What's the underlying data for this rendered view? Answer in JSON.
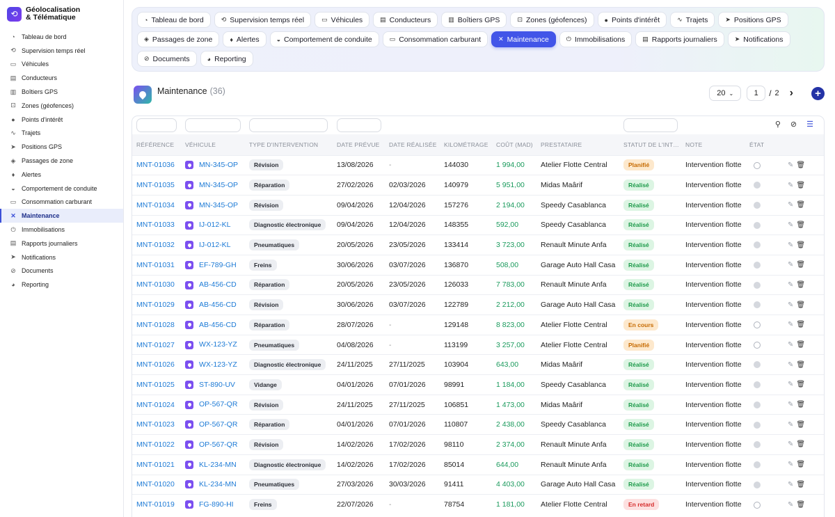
{
  "brand": {
    "line1": "Géolocalisation",
    "line2": "& Télématique"
  },
  "sidebar": {
    "items": [
      {
        "label": "Tableau de bord",
        "icon": "◔"
      },
      {
        "label": "Supervision temps réel",
        "icon": "⟲"
      },
      {
        "label": "Véhicules",
        "icon": "▭"
      },
      {
        "label": "Conducteurs",
        "icon": "▤"
      },
      {
        "label": "Boîtiers GPS",
        "icon": "▥"
      },
      {
        "label": "Zones (géofences)",
        "icon": "⊡"
      },
      {
        "label": "Points d'intérêt",
        "icon": "●"
      },
      {
        "label": "Trajets",
        "icon": "∿"
      },
      {
        "label": "Positions GPS",
        "icon": "➤"
      },
      {
        "label": "Passages de zone",
        "icon": "◈"
      },
      {
        "label": "Alertes",
        "icon": "♦"
      },
      {
        "label": "Comportement de conduite",
        "icon": "◒"
      },
      {
        "label": "Consommation carburant",
        "icon": "▭"
      },
      {
        "label": "Maintenance",
        "icon": "✕"
      },
      {
        "label": "Immobilisations",
        "icon": "⏻"
      },
      {
        "label": "Rapports journaliers",
        "icon": "▤"
      },
      {
        "label": "Notifications",
        "icon": "➤"
      },
      {
        "label": "Documents",
        "icon": "⊘"
      },
      {
        "label": "Reporting",
        "icon": "◕"
      }
    ],
    "active_index": 13
  },
  "tabs": [
    {
      "label": "Tableau de bord",
      "icon": "◔"
    },
    {
      "label": "Supervision temps réel",
      "icon": "⟲"
    },
    {
      "label": "Véhicules",
      "icon": "▭"
    },
    {
      "label": "Conducteurs",
      "icon": "▤"
    },
    {
      "label": "Boîtiers GPS",
      "icon": "▥"
    },
    {
      "label": "Zones (géofences)",
      "icon": "⊡"
    },
    {
      "label": "Points d'intérêt",
      "icon": "●"
    },
    {
      "label": "Trajets",
      "icon": "∿"
    },
    {
      "label": "Positions GPS",
      "icon": "➤"
    },
    {
      "label": "Passages de zone",
      "icon": "◈"
    },
    {
      "label": "Alertes",
      "icon": "♦"
    },
    {
      "label": "Comportement de conduite",
      "icon": "◒"
    },
    {
      "label": "Consommation carburant",
      "icon": "▭"
    },
    {
      "label": "Maintenance",
      "icon": "✕"
    },
    {
      "label": "Immobilisations",
      "icon": "⏻"
    },
    {
      "label": "Rapports journaliers",
      "icon": "▤"
    },
    {
      "label": "Notifications",
      "icon": "➤"
    },
    {
      "label": "Documents",
      "icon": "⊘"
    },
    {
      "label": "Reporting",
      "icon": "◕"
    }
  ],
  "active_tab": 13,
  "page": {
    "title": "Maintenance",
    "count": "(36)"
  },
  "pager": {
    "page_size": "20",
    "current_page": "1",
    "separator": "/",
    "total_pages": "2"
  },
  "table": {
    "columns": [
      "RÉFÉRENCE",
      "VÉHICULE",
      "TYPE D'INTERVENTION",
      "DATE PRÉVUE",
      "DATE RÉALISÉE",
      "KILOMÉTRAGE",
      "COÛT (MAD)",
      "PRESTATAIRE",
      "STATUT DE L'INTERVENTION",
      "NOTE",
      "ÉTAT"
    ],
    "rows": [
      {
        "ref": "MNT-01036",
        "vehicle": "MN-345-OP",
        "type": "Révision",
        "planned": "13/08/2026",
        "done": "-",
        "km": "144030",
        "cost": "1 994,00",
        "provider": "Atelier Flotte Central",
        "status": "Planifié",
        "status_kind": "plan",
        "note": "Intervention flotte",
        "state": "open"
      },
      {
        "ref": "MNT-01035",
        "vehicle": "MN-345-OP",
        "type": "Réparation",
        "planned": "27/02/2026",
        "done": "02/03/2026",
        "km": "140979",
        "cost": "5 951,00",
        "provider": "Midas Maârif",
        "status": "Réalisé",
        "status_kind": "ok",
        "note": "Intervention flotte",
        "state": "full"
      },
      {
        "ref": "MNT-01034",
        "vehicle": "MN-345-OP",
        "type": "Révision",
        "planned": "09/04/2026",
        "done": "12/04/2026",
        "km": "157276",
        "cost": "2 194,00",
        "provider": "Speedy Casablanca",
        "status": "Réalisé",
        "status_kind": "ok",
        "note": "Intervention flotte",
        "state": "full"
      },
      {
        "ref": "MNT-01033",
        "vehicle": "IJ-012-KL",
        "type": "Diagnostic électronique",
        "planned": "09/04/2026",
        "done": "12/04/2026",
        "km": "148355",
        "cost": "592,00",
        "provider": "Speedy Casablanca",
        "status": "Réalisé",
        "status_kind": "ok",
        "note": "Intervention flotte",
        "state": "full"
      },
      {
        "ref": "MNT-01032",
        "vehicle": "IJ-012-KL",
        "type": "Pneumatiques",
        "planned": "20/05/2026",
        "done": "23/05/2026",
        "km": "133414",
        "cost": "3 723,00",
        "provider": "Renault Minute Anfa",
        "status": "Réalisé",
        "status_kind": "ok",
        "note": "Intervention flotte",
        "state": "full"
      },
      {
        "ref": "MNT-01031",
        "vehicle": "EF-789-GH",
        "type": "Freins",
        "planned": "30/06/2026",
        "done": "03/07/2026",
        "km": "136870",
        "cost": "508,00",
        "provider": "Garage Auto Hall Casa",
        "status": "Réalisé",
        "status_kind": "ok",
        "note": "Intervention flotte",
        "state": "full"
      },
      {
        "ref": "MNT-01030",
        "vehicle": "AB-456-CD",
        "type": "Réparation",
        "planned": "20/05/2026",
        "done": "23/05/2026",
        "km": "126033",
        "cost": "7 783,00",
        "provider": "Renault Minute Anfa",
        "status": "Réalisé",
        "status_kind": "ok",
        "note": "Intervention flotte",
        "state": "full"
      },
      {
        "ref": "MNT-01029",
        "vehicle": "AB-456-CD",
        "type": "Révision",
        "planned": "30/06/2026",
        "done": "03/07/2026",
        "km": "122789",
        "cost": "2 212,00",
        "provider": "Garage Auto Hall Casa",
        "status": "Réalisé",
        "status_kind": "ok",
        "note": "Intervention flotte",
        "state": "full"
      },
      {
        "ref": "MNT-01028",
        "vehicle": "AB-456-CD",
        "type": "Réparation",
        "planned": "28/07/2026",
        "done": "-",
        "km": "129148",
        "cost": "8 823,00",
        "provider": "Atelier Flotte Central",
        "status": "En cours",
        "status_kind": "cours",
        "note": "Intervention flotte",
        "state": "open"
      },
      {
        "ref": "MNT-01027",
        "vehicle": "WX-123-YZ",
        "type": "Pneumatiques",
        "planned": "04/08/2026",
        "done": "-",
        "km": "113199",
        "cost": "3 257,00",
        "provider": "Atelier Flotte Central",
        "status": "Planifié",
        "status_kind": "plan",
        "note": "Intervention flotte",
        "state": "open"
      },
      {
        "ref": "MNT-01026",
        "vehicle": "WX-123-YZ",
        "type": "Diagnostic électronique",
        "planned": "24/11/2025",
        "done": "27/11/2025",
        "km": "103904",
        "cost": "643,00",
        "provider": "Midas Maârif",
        "status": "Réalisé",
        "status_kind": "ok",
        "note": "Intervention flotte",
        "state": "full"
      },
      {
        "ref": "MNT-01025",
        "vehicle": "ST-890-UV",
        "type": "Vidange",
        "planned": "04/01/2026",
        "done": "07/01/2026",
        "km": "98991",
        "cost": "1 184,00",
        "provider": "Speedy Casablanca",
        "status": "Réalisé",
        "status_kind": "ok",
        "note": "Intervention flotte",
        "state": "full"
      },
      {
        "ref": "MNT-01024",
        "vehicle": "OP-567-QR",
        "type": "Révision",
        "planned": "24/11/2025",
        "done": "27/11/2025",
        "km": "106851",
        "cost": "1 473,00",
        "provider": "Midas Maârif",
        "status": "Réalisé",
        "status_kind": "ok",
        "note": "Intervention flotte",
        "state": "full"
      },
      {
        "ref": "MNT-01023",
        "vehicle": "OP-567-QR",
        "type": "Réparation",
        "planned": "04/01/2026",
        "done": "07/01/2026",
        "km": "110807",
        "cost": "2 438,00",
        "provider": "Speedy Casablanca",
        "status": "Réalisé",
        "status_kind": "ok",
        "note": "Intervention flotte",
        "state": "full"
      },
      {
        "ref": "MNT-01022",
        "vehicle": "OP-567-QR",
        "type": "Révision",
        "planned": "14/02/2026",
        "done": "17/02/2026",
        "km": "98110",
        "cost": "2 374,00",
        "provider": "Renault Minute Anfa",
        "status": "Réalisé",
        "status_kind": "ok",
        "note": "Intervention flotte",
        "state": "full"
      },
      {
        "ref": "MNT-01021",
        "vehicle": "KL-234-MN",
        "type": "Diagnostic électronique",
        "planned": "14/02/2026",
        "done": "17/02/2026",
        "km": "85014",
        "cost": "644,00",
        "provider": "Renault Minute Anfa",
        "status": "Réalisé",
        "status_kind": "ok",
        "note": "Intervention flotte",
        "state": "full"
      },
      {
        "ref": "MNT-01020",
        "vehicle": "KL-234-MN",
        "type": "Pneumatiques",
        "planned": "27/03/2026",
        "done": "30/03/2026",
        "km": "91411",
        "cost": "4 403,00",
        "provider": "Garage Auto Hall Casa",
        "status": "Réalisé",
        "status_kind": "ok",
        "note": "Intervention flotte",
        "state": "full"
      },
      {
        "ref": "MNT-01019",
        "vehicle": "FG-890-HI",
        "type": "Freins",
        "planned": "22/07/2026",
        "done": "-",
        "km": "78754",
        "cost": "1 181,00",
        "provider": "Atelier Flotte Central",
        "status": "En retard",
        "status_kind": "late",
        "note": "Intervention flotte",
        "state": "open"
      }
    ]
  },
  "colors": {
    "accent": "#4255e8",
    "link": "#1e7bd6",
    "cost": "#1a9a5c",
    "status_ok": "#1e9b4b",
    "status_plan": "#c66a00",
    "status_late": "#d62d2d"
  }
}
